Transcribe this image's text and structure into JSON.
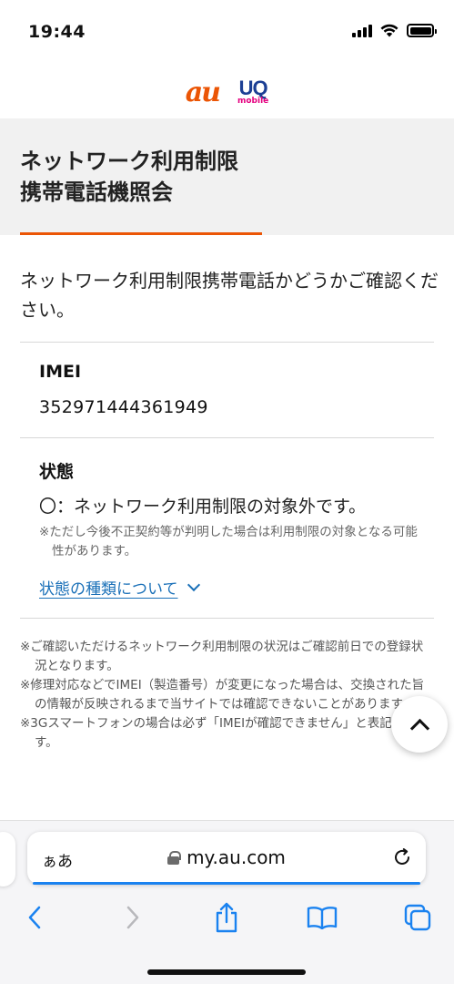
{
  "status_bar": {
    "time": "19:44"
  },
  "logos": {
    "au": "au",
    "uq": "UQ",
    "uq_sub": "mobile"
  },
  "page": {
    "title": "ネットワーク利用制限\n携帯電話機照会",
    "intro": "ネットワーク利用制限携帯電話かどうかご確認ください。"
  },
  "imei": {
    "label": "IMEI",
    "value": "352971444361949"
  },
  "state": {
    "label": "状態",
    "value": "〇：ネットワーク利用制限の対象外です。",
    "note": "※ただし今後不正契約等が判明した場合は利用制限の対象となる可能性があります。",
    "link": "状態の種類について"
  },
  "notes": [
    "※ご確認いただけるネットワーク利用制限の状況はご確認前日での登録状況となります。",
    "※修理対応などでIMEI（製造番号）が変更になった場合は、交換された旨の情報が反映されるまで当サイトでは確認できないことがあります。",
    "※3Gスマートフォンの場合は必ず「IMEIが確認できません」と表記されます。"
  ],
  "browser": {
    "aa_label": "ぁあ",
    "url": "my.au.com"
  },
  "colors": {
    "au_orange": "#eb5505",
    "link_blue": "#1a70b8",
    "safari_blue": "#1a82f0"
  }
}
